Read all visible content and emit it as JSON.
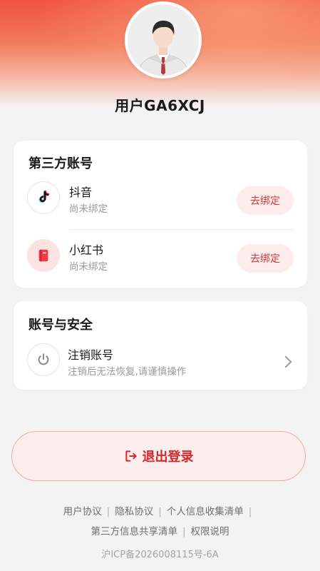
{
  "profile": {
    "username": "用户GA6XCJ"
  },
  "third_party": {
    "title": "第三方账号",
    "items": [
      {
        "name": "抖音",
        "status": "尚未绑定",
        "action": "去绑定",
        "icon": "tiktok-icon"
      },
      {
        "name": "小红书",
        "status": "尚未绑定",
        "action": "去绑定",
        "icon": "xiaohongshu-icon"
      }
    ]
  },
  "security": {
    "title": "账号与安全",
    "items": [
      {
        "name": "注销账号",
        "desc": "注销后无法恢复,请谨慎操作",
        "icon": "power-icon"
      }
    ]
  },
  "logout": {
    "label": "退出登录",
    "icon": "logout-icon"
  },
  "footer": {
    "links_row1": [
      "用户协议",
      "隐私协议",
      "个人信息收集清单"
    ],
    "links_row2": [
      "第三方信息共享清单",
      "权限说明"
    ],
    "separator": "|",
    "icp": "沪ICP备2026008115号-6A"
  },
  "colors": {
    "brand_red": "#d9262b",
    "button_bg": "#fdecec",
    "header_gradient_start": "#f0533f"
  }
}
